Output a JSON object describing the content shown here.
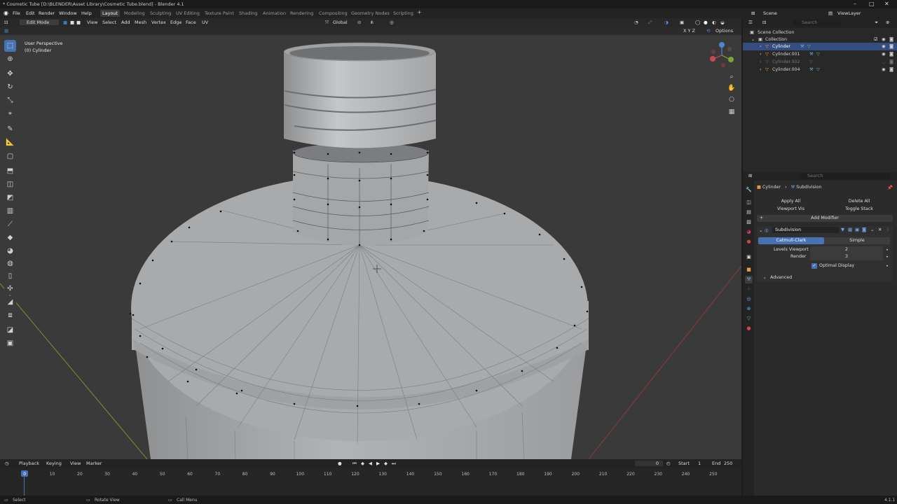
{
  "window": {
    "title": "* Cosmetic Tube [D:\\BLENDER\\Asset Library\\Cosmetic Tube.blend] - Blender 4.1"
  },
  "menu": [
    "File",
    "Edit",
    "Render",
    "Window",
    "Help"
  ],
  "workspaces": [
    "Layout",
    "Modeling",
    "Sculpting",
    "UV Editing",
    "Texture Paint",
    "Shading",
    "Animation",
    "Rendering",
    "Compositing",
    "Geometry Nodes",
    "Scripting"
  ],
  "active_workspace": "Layout",
  "scene": {
    "label": "Scene",
    "view_layer": "ViewLayer"
  },
  "viewport_header": {
    "mode": "Edit Mode",
    "menus": [
      "View",
      "Select",
      "Add",
      "Mesh",
      "Vertex",
      "Edge",
      "Face",
      "UV"
    ],
    "transform_orientation": "Global",
    "options": "Options",
    "axes": "X Y Z"
  },
  "viewport": {
    "perspective": "User Perspective",
    "object": "(0) Cylinder"
  },
  "outliner": {
    "search_placeholder": "Search",
    "root": "Scene Collection",
    "collection": "Collection",
    "items": [
      "Cylinder",
      "Cylinder.001",
      "Cylinder.002",
      "Cylinder.004"
    ],
    "selected": "Cylinder"
  },
  "properties": {
    "search_placeholder": "Search",
    "breadcrumb_object": "Cylinder",
    "breadcrumb_modifier": "Subdivision",
    "apply_all": "Apply All",
    "delete_all": "Delete All",
    "viewport_vis": "Viewport Vis",
    "toggle_stack": "Toggle Stack",
    "add_modifier": "Add Modifier",
    "modifier_name": "Subdivision",
    "catmull": "Catmull-Clark",
    "simple": "Simple",
    "levels_viewport_label": "Levels Viewport",
    "levels_viewport_value": "2",
    "render_label": "Render",
    "render_value": "3",
    "optimal_display": "Optimal Display",
    "advanced": "Advanced"
  },
  "timeline": {
    "menus": [
      "Playback",
      "Keying",
      "View",
      "Marker"
    ],
    "current_frame": "0",
    "start_label": "Start",
    "start": "1",
    "end_label": "End",
    "end": "250",
    "ticks": [
      "0",
      "10",
      "20",
      "30",
      "40",
      "50",
      "60",
      "70",
      "80",
      "90",
      "100",
      "110",
      "120",
      "130",
      "140",
      "150",
      "160",
      "170",
      "180",
      "190",
      "200",
      "210",
      "220",
      "230",
      "240",
      "250"
    ]
  },
  "status": {
    "select": "Select",
    "rotate": "Rotate View",
    "call_menu": "Call Menu",
    "version": "4.1.1"
  }
}
